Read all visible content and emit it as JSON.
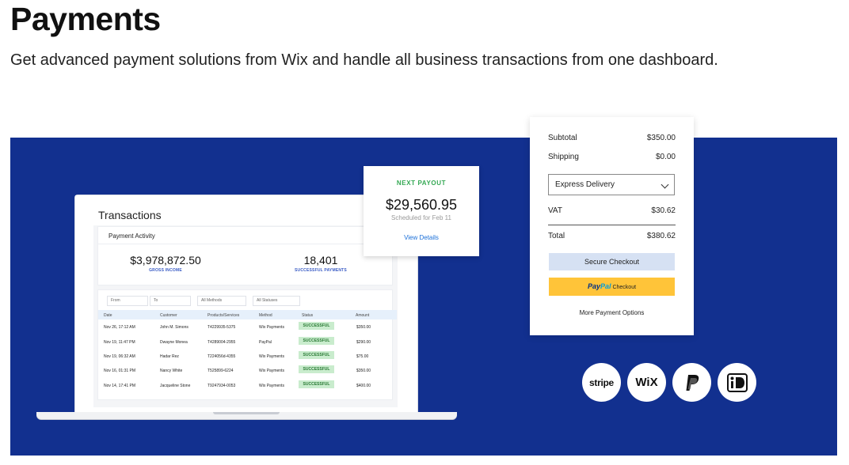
{
  "header": {
    "title": "Payments",
    "subtitle": "Get advanced payment solutions from Wix and handle all business transactions from one dashboard."
  },
  "colors": {
    "banner": "#12308f",
    "success": "#34a853",
    "paypal": "#ffc439",
    "link": "#1a6fd8"
  },
  "dashboard": {
    "title": "Transactions",
    "panel_label": "Payment Activity",
    "gross_income": {
      "value": "$3,978,872.50",
      "caption": "GROSS INCOME"
    },
    "successful_payments": {
      "value": "18,401",
      "caption": "SUCCESSFUL PAYMENTS"
    },
    "filters": {
      "from": "From",
      "to": "To",
      "methods": "All Methods",
      "statuses": "All Statuses"
    },
    "columns": [
      "Date",
      "Customer",
      "Products/Services",
      "Method",
      "Status",
      "Amount"
    ],
    "rows": [
      {
        "date": "Nov 26, 17:12 AM",
        "customer": "John M. Simons",
        "product": "T4229935-5375",
        "method": "Wix Payments",
        "status": "SUCCESSFUL",
        "amount": "$350.00"
      },
      {
        "date": "Nov 19, 11:47 PM",
        "customer": "Dwayne Monea",
        "product": "T4289004-2955",
        "method": "PayPal",
        "status": "SUCCESSFUL",
        "amount": "$290.00"
      },
      {
        "date": "Nov 19, 06:32 AM",
        "customer": "Hadar Rez",
        "product": "T224056d-4355",
        "method": "Wix Payments",
        "status": "SUCCESSFUL",
        "amount": "$75.00"
      },
      {
        "date": "Nov 16, 01:31 PM",
        "customer": "Nancy White",
        "product": "T525899-6224",
        "method": "Wix Payments",
        "status": "SUCCESSFUL",
        "amount": "$350.00"
      },
      {
        "date": "Nov 14, 17:41 PM",
        "customer": "Jacqueline Stone",
        "product": "T9247934-0053",
        "method": "Wix Payments",
        "status": "SUCCESSFUL",
        "amount": "$400.00"
      }
    ]
  },
  "payout": {
    "label": "NEXT PAYOUT",
    "amount": "$29,560.95",
    "schedule": "Scheduled for Feb 11",
    "link": "View Details"
  },
  "checkout": {
    "subtotal_label": "Subtotal",
    "subtotal": "$350.00",
    "shipping_label": "Shipping",
    "shipping": "$0.00",
    "delivery_option": "Express Delivery",
    "vat_label": "VAT",
    "vat": "$30.62",
    "total_label": "Total",
    "total": "$380.62",
    "secure_button": "Secure Checkout",
    "paypal_pay": "Pay",
    "paypal_pal": "Pal",
    "paypal_suffix": "Checkout",
    "more_options": "More Payment Options"
  },
  "logos": {
    "stripe": "stripe",
    "wix": "WiX",
    "icons": [
      "stripe-logo",
      "wix-logo",
      "paypal-logo",
      "ideal-logo"
    ]
  }
}
